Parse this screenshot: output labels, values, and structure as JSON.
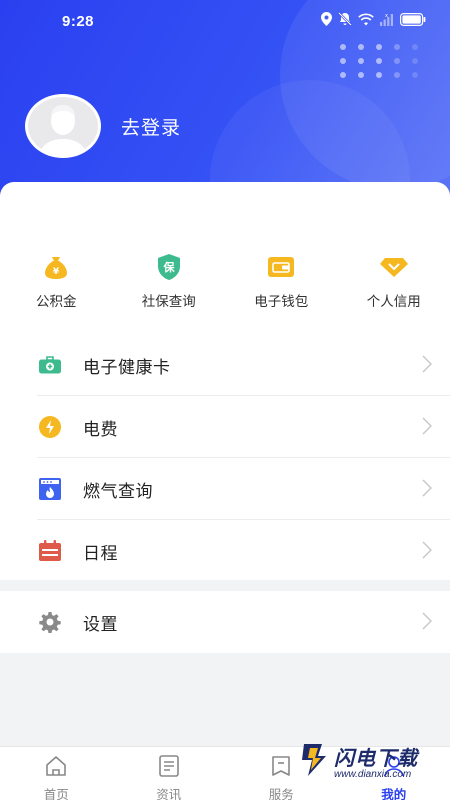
{
  "status_bar": {
    "time": "9:28"
  },
  "profile": {
    "login_label": "去登录"
  },
  "quick_actions": [
    {
      "label": "公积金",
      "icon": "money-bag-icon",
      "color": "#f5b820"
    },
    {
      "label": "社保查询",
      "icon": "shield-icon",
      "color": "#3dbb8f",
      "glyph": "保"
    },
    {
      "label": "电子钱包",
      "icon": "wallet-icon",
      "color": "#f5b820"
    },
    {
      "label": "个人信用",
      "icon": "diamond-icon",
      "color": "#f5b820"
    }
  ],
  "menu": [
    {
      "label": "电子健康卡",
      "icon": "medical-kit-icon",
      "color": "#3dbb8f"
    },
    {
      "label": "电费",
      "icon": "lightning-icon",
      "color": "#f5b820"
    },
    {
      "label": "燃气查询",
      "icon": "gas-stove-icon",
      "color": "#3d63f0"
    },
    {
      "label": "日程",
      "icon": "calendar-icon",
      "color": "#e05a4a"
    }
  ],
  "settings": {
    "label": "设置",
    "icon": "gear-icon"
  },
  "tabbar": [
    {
      "label": "首页",
      "icon": "home-icon",
      "active": false
    },
    {
      "label": "资讯",
      "icon": "news-icon",
      "active": false
    },
    {
      "label": "服务",
      "icon": "service-icon",
      "active": false
    },
    {
      "label": "我的",
      "icon": "person-icon",
      "active": true
    }
  ],
  "watermark": {
    "title": "闪电下载",
    "subtitle": "www.dianxia.com"
  },
  "colors": {
    "primary": "#2a40f0",
    "accent_yellow": "#f5b820",
    "accent_green": "#3dbb8f"
  }
}
